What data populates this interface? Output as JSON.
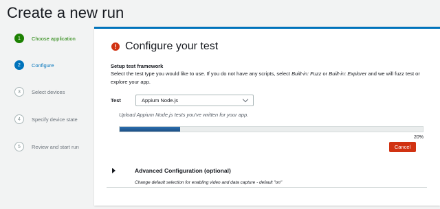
{
  "page": {
    "title": "Create a new run"
  },
  "wizard": {
    "steps": [
      {
        "number": "1",
        "label": "Choose application",
        "state": "done"
      },
      {
        "number": "2",
        "label": "Configure",
        "state": "active"
      },
      {
        "number": "3",
        "label": "Select devices",
        "state": "todo"
      },
      {
        "number": "4",
        "label": "Specify device state",
        "state": "todo"
      },
      {
        "number": "5",
        "label": "Review and start run",
        "state": "todo"
      }
    ]
  },
  "panel": {
    "error_icon": "!",
    "title": "Configure your test",
    "setup": {
      "heading": "Setup test framework",
      "desc_part1": "Select the test type you would like to use. If you do not have any scripts, select ",
      "desc_fuzz": "Built-in: Fuzz",
      "desc_or": " or ",
      "desc_explorer": "Built-in: Explorer",
      "desc_part2": " and we will fuzz test or explore your app."
    },
    "test_select": {
      "label": "Test",
      "value": "Appium Node.js"
    },
    "upload_note": "Upload Appium Node.js tests you've written for your app.",
    "progress": {
      "value": 0.2,
      "label": "20%"
    },
    "cancel_label": "Cancel",
    "advanced": {
      "title": "Advanced Configuration (optional)",
      "desc": "Change default selection for enabling video and data capture - default \"on\""
    }
  },
  "colors": {
    "accent": "#0073bb",
    "success": "#1d8102",
    "danger": "#d13212",
    "progress": "#1d4f83"
  },
  "icons": {
    "error": "exclamation-circle-icon",
    "dropdown": "chevron-down-icon",
    "expand": "caret-right-icon"
  }
}
